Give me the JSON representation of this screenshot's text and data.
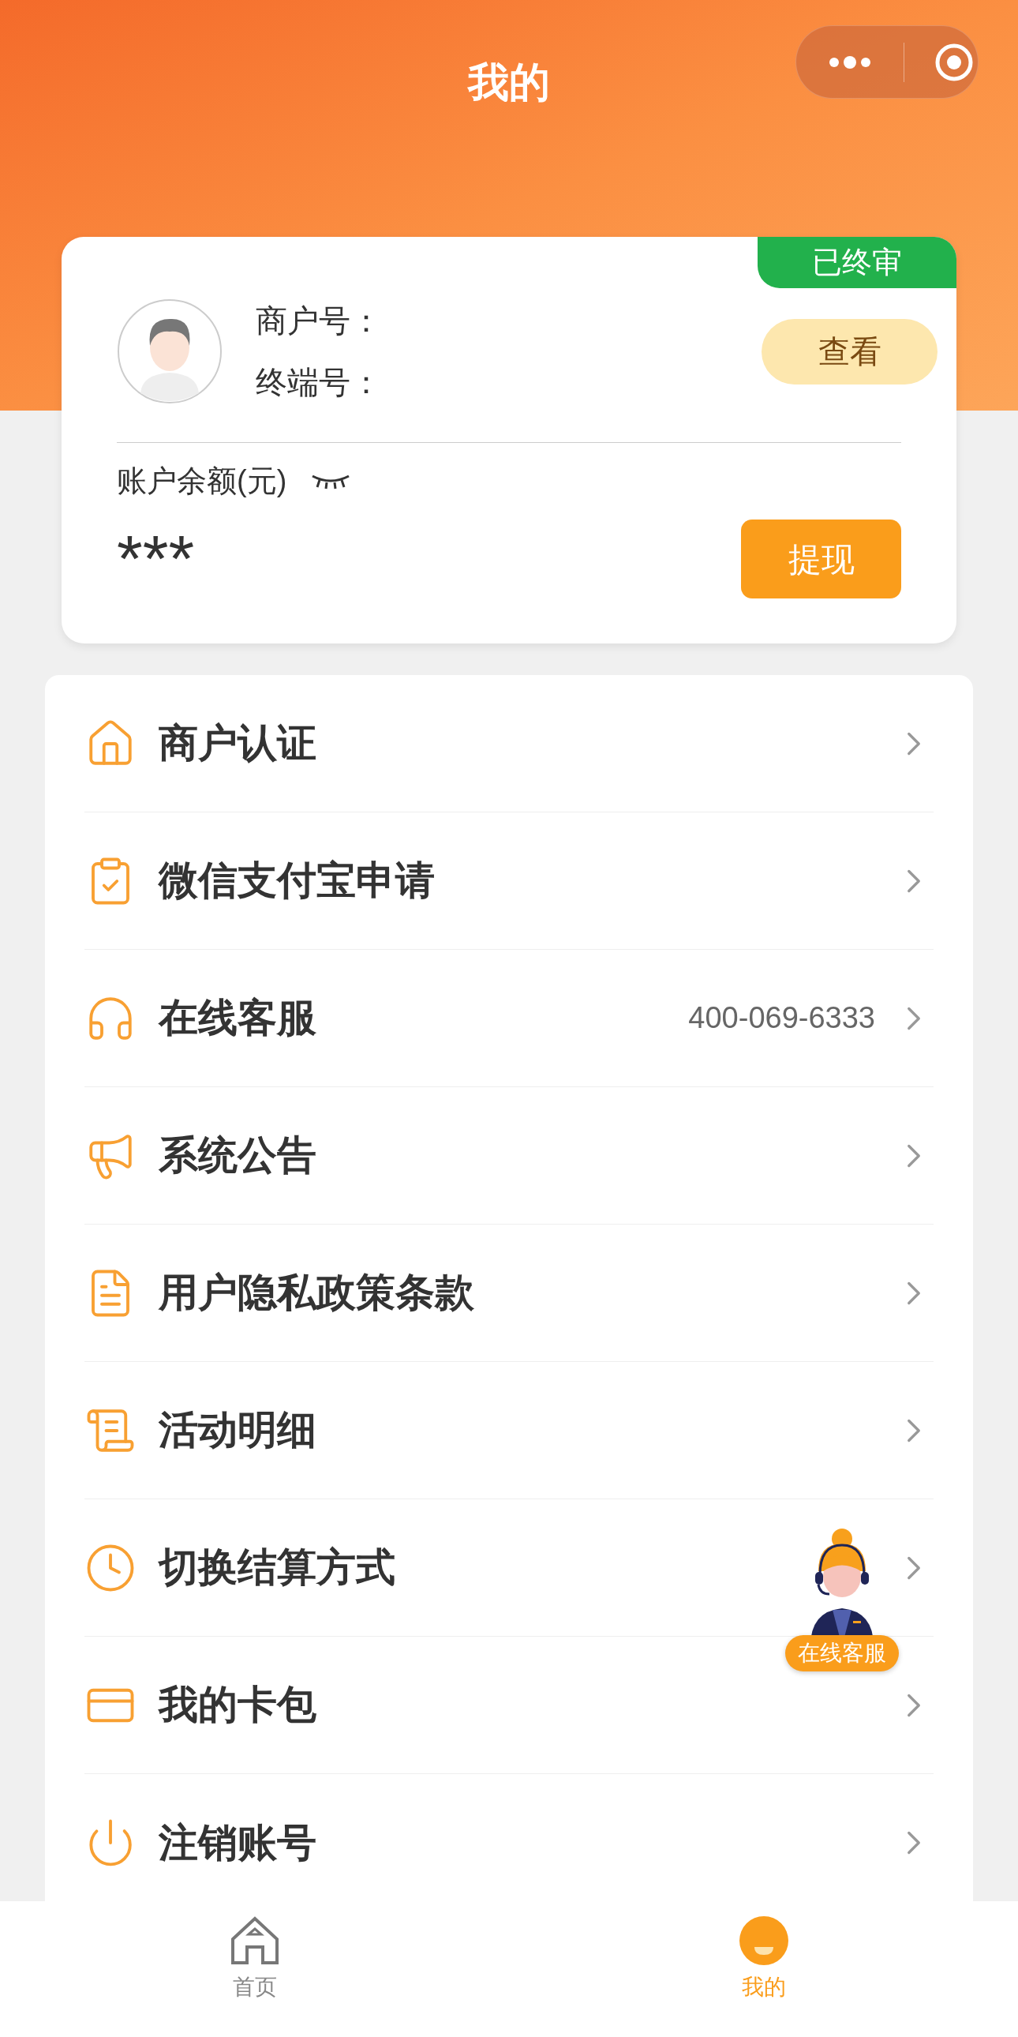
{
  "header": {
    "title": "我的"
  },
  "account_card": {
    "status_badge": "已终审",
    "merchant_label": "商户号：",
    "terminal_label": "终端号：",
    "view_button": "查看",
    "balance_label": "账户余额(元)",
    "balance_hidden": true,
    "balance": "***",
    "withdraw_button": "提现"
  },
  "menu": [
    {
      "label": "商户认证"
    },
    {
      "label": "微信支付宝申请"
    },
    {
      "label": "在线客服",
      "value": "400-069-6333"
    },
    {
      "label": "系统公告"
    },
    {
      "label": "用户隐私政策条款"
    },
    {
      "label": "活动明细"
    },
    {
      "label": "切换结算方式"
    },
    {
      "label": "我的卡包"
    },
    {
      "label": "注销账号"
    }
  ],
  "floating_service": {
    "label": "在线客服"
  },
  "tab_bar": [
    {
      "label": "首页",
      "selected": false
    },
    {
      "label": "我的",
      "selected": true
    }
  ]
}
